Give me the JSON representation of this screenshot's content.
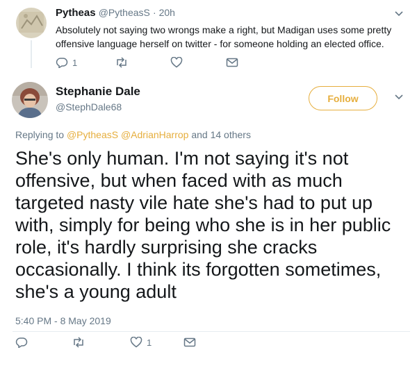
{
  "reply_tweet": {
    "name": "Pytheas",
    "handle": "@PytheasS",
    "time": "· 20h",
    "text": "Absolutely not saying two wrongs make a right, but Madigan uses some pretty offensive language herself on twitter - for someone holding an elected office.",
    "actions": {
      "reply_count": "1",
      "retweet_count": "",
      "like_count": ""
    }
  },
  "main_tweet": {
    "name": "Stephanie Dale",
    "handle": "@StephDale68",
    "follow_label": "Follow",
    "replying_prefix": "Replying to",
    "replying_to_1": "@PytheasS",
    "replying_to_2": "@AdrianHarrop",
    "replying_suffix": "and 14 others",
    "text": "She's only human. I'm not saying it's not offensive, but when faced with as much targeted nasty vile hate she's had to put up with, simply for being who she is in her public role, it's hardly surprising she cracks occasionally. I think its forgotten sometimes, she's a young adult",
    "timestamp": "5:40 PM - 8 May 2019",
    "actions": {
      "reply_count": "",
      "retweet_count": "",
      "like_count": "1"
    }
  },
  "colors": {
    "accent": "#e6ae3d",
    "secondary_text": "#657786",
    "divider": "#e6ecf0"
  },
  "icons": [
    "reply-icon",
    "retweet-icon",
    "like-icon",
    "message-icon",
    "chevron-down-icon"
  ]
}
